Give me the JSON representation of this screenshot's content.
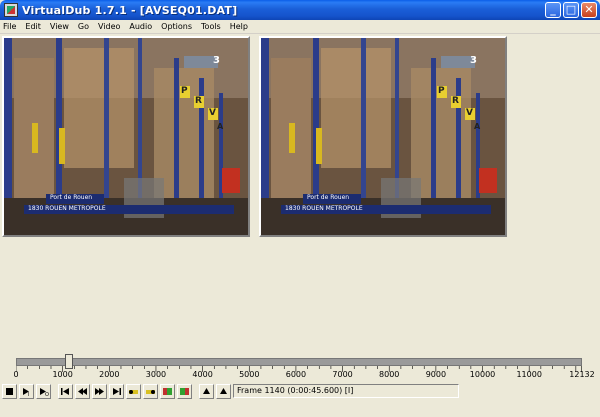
{
  "window": {
    "title": "VirtualDub 1.7.1 - [AVSEQ01.DAT]",
    "minimize": "_",
    "maximize": "□",
    "close": "✕"
  },
  "menu": [
    "File",
    "Edit",
    "View",
    "Go",
    "Video",
    "Audio",
    "Options",
    "Tools",
    "Help"
  ],
  "video": {
    "caption_line1": "Port de Rouen",
    "caption_line2": "1830 ROUEN METROPOLE",
    "channel_logo": "3",
    "signs": [
      "P",
      "R",
      "V",
      "A"
    ]
  },
  "timeline": {
    "min": 0,
    "max": 12132,
    "position": 1140,
    "tick_labels": [
      "0",
      "1000",
      "2000",
      "3000",
      "4000",
      "5000",
      "6000",
      "7000",
      "8000",
      "9000",
      "10000",
      "11000",
      "12132"
    ]
  },
  "toolbar": {
    "buttons": [
      "stop-button",
      "play-input-button",
      "play-output-button",
      "go-start-button",
      "prev-frame-button",
      "next-frame-button",
      "go-end-button",
      "prev-key-button",
      "next-key-button",
      "scene-back-button",
      "scene-forward-button",
      "mark-in-button",
      "mark-out-button"
    ]
  },
  "status": {
    "frame_text": "Frame 1140 (0:00:45.600) [I]"
  }
}
